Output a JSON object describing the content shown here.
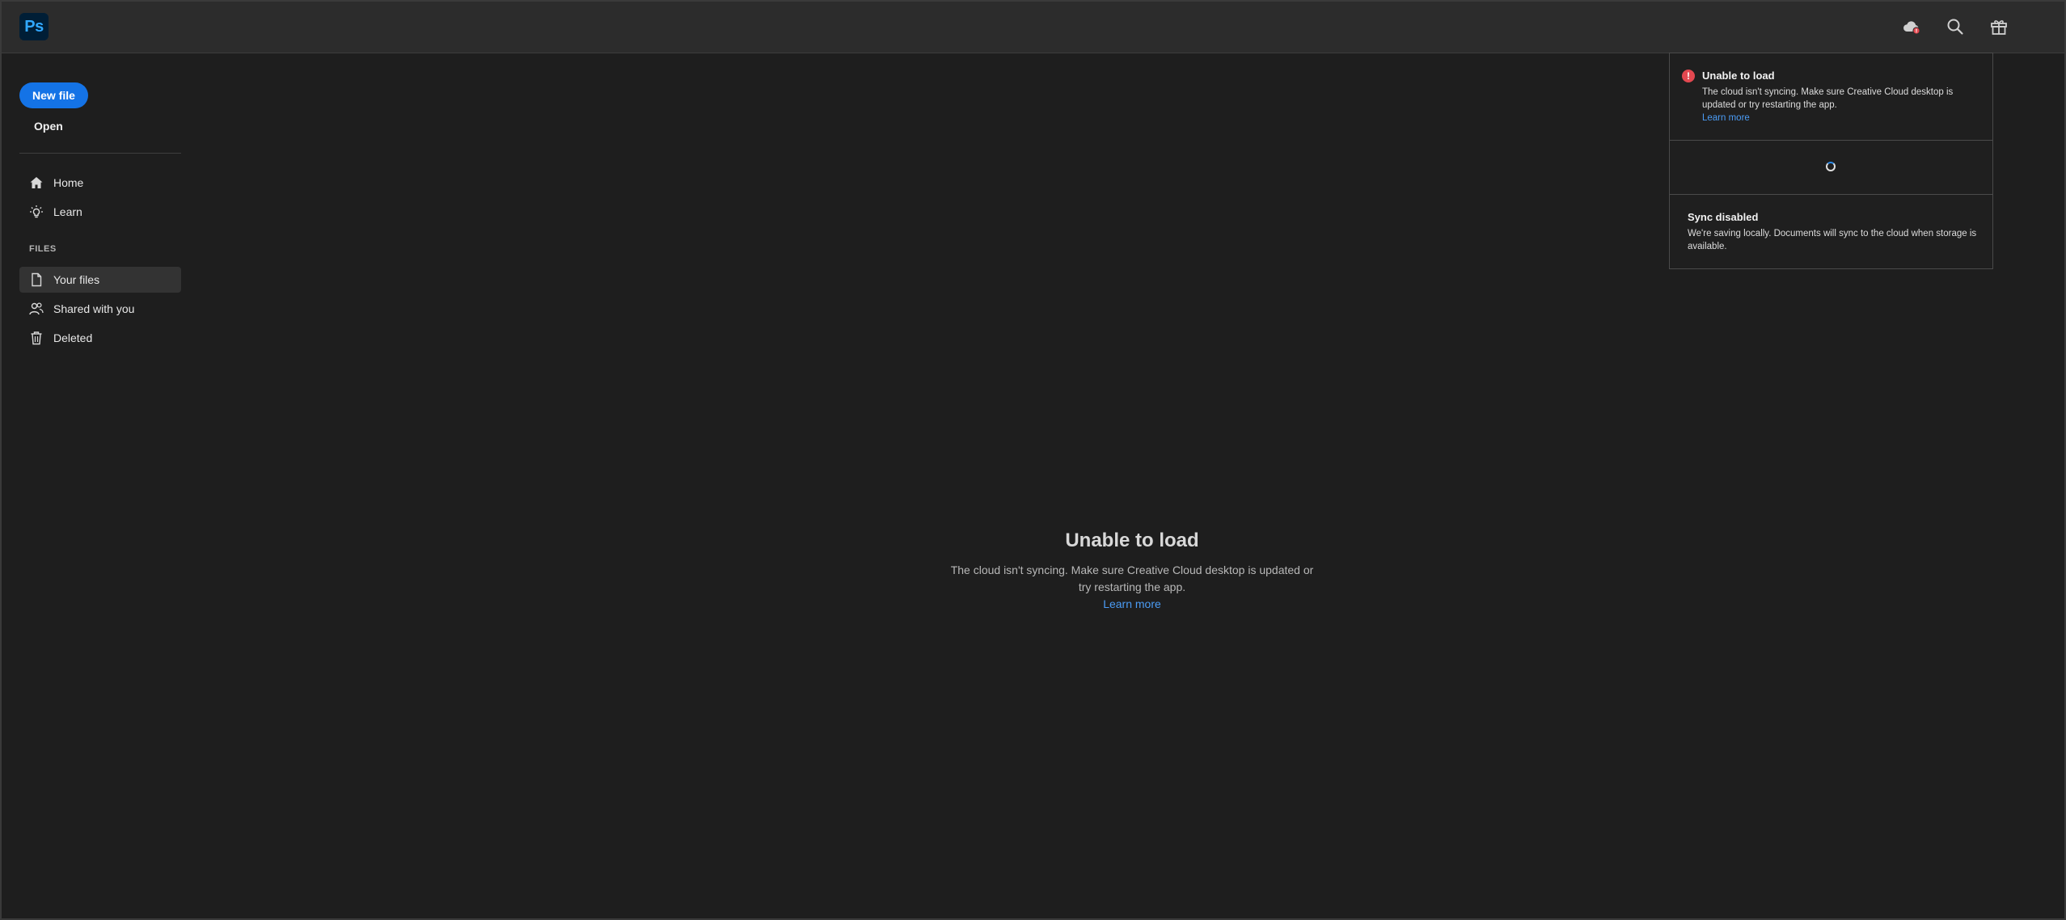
{
  "header": {
    "app_logo": "Ps",
    "icons": [
      "cloud-error-icon",
      "search-icon",
      "gift-icon"
    ]
  },
  "sidebar": {
    "new_file_label": "New file",
    "open_label": "Open",
    "nav": [
      {
        "label": "Home",
        "icon": "home-icon"
      },
      {
        "label": "Learn",
        "icon": "lightbulb-icon"
      }
    ],
    "files_heading": "FILES",
    "files": [
      {
        "label": "Your files",
        "icon": "document-icon",
        "active": true
      },
      {
        "label": "Shared with you",
        "icon": "people-icon",
        "active": false
      },
      {
        "label": "Deleted",
        "icon": "trash-icon",
        "active": false
      }
    ]
  },
  "main": {
    "title": "Unable to load",
    "description": "The cloud isn't syncing. Make sure Creative Cloud desktop is updated or try restarting the app.",
    "link": "Learn more"
  },
  "popover": {
    "error": {
      "icon": "alert-icon",
      "title": "Unable to load",
      "body": "The cloud isn't syncing. Make sure Creative Cloud desktop is updated or try restarting the app.",
      "link": "Learn more"
    },
    "sync": {
      "title": "Sync disabled",
      "body": "We're saving locally. Documents will sync to the cloud when storage is available."
    }
  },
  "colors": {
    "accent": "#1473e6",
    "link": "#4b9cf5",
    "error": "#e34850",
    "background": "#1e1e1e",
    "header": "#2c2c2c"
  }
}
